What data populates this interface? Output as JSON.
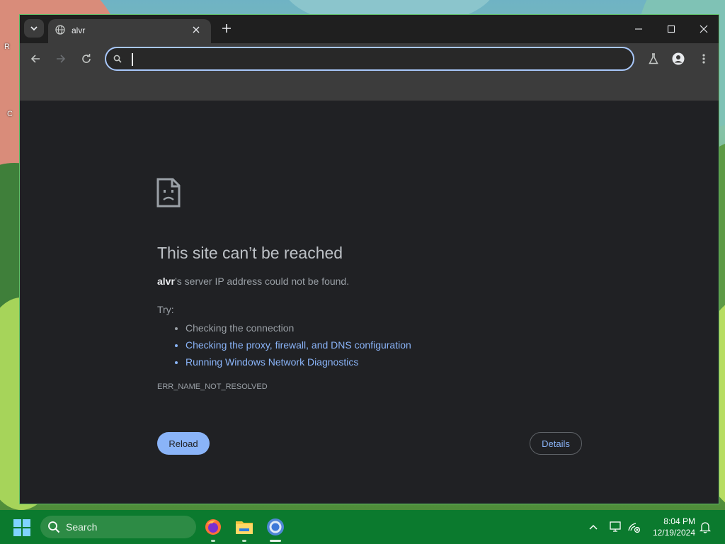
{
  "browser": {
    "tab_title": "alvr",
    "address_value": "",
    "address_placeholder": ""
  },
  "error_page": {
    "title": "This site can’t be reached",
    "host": "alvr",
    "desc_rest": "’s server IP address could not be found.",
    "try_label": "Try:",
    "suggestions": [
      "Checking the connection",
      "Checking the proxy, firewall, and DNS configuration",
      "Running Windows Network Diagnostics"
    ],
    "error_code": "ERR_NAME_NOT_RESOLVED",
    "reload_label": "Reload",
    "details_label": "Details"
  },
  "taskbar": {
    "search_label": "Search",
    "time": "8:04 PM",
    "date": "12/19/2024"
  },
  "colors": {
    "accent": "#8ab4f8",
    "omnibox_focus": "#a8c7fa",
    "taskbar": "#0b7a2e"
  },
  "icons": [
    "tab-search-icon",
    "globe-icon",
    "close-icon",
    "plus-icon",
    "minimize-icon",
    "maximize-icon",
    "back-icon",
    "forward-icon",
    "reload-icon",
    "search-icon",
    "flask-icon",
    "profile-icon",
    "more-icon",
    "sad-page-icon",
    "windows-icon",
    "firefox-icon",
    "file-explorer-icon",
    "chrome-icon",
    "chevron-up-icon",
    "network-icon",
    "notification-icon"
  ]
}
